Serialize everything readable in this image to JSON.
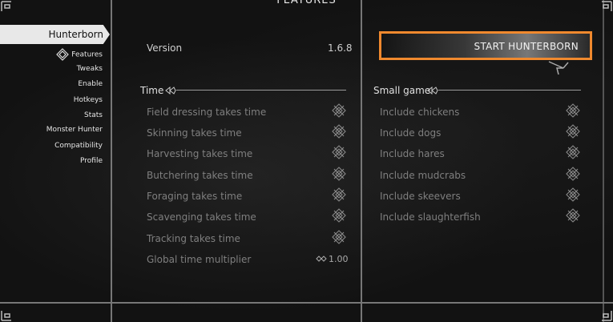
{
  "page_title": "FEATURES",
  "sidebar": {
    "selected": "Hunterborn",
    "items": [
      {
        "label": "Features",
        "icon": "knot-icon"
      },
      {
        "label": "Tweaks"
      },
      {
        "label": "Enable"
      },
      {
        "label": "Hotkeys"
      },
      {
        "label": "Stats"
      },
      {
        "label": "Monster Hunter"
      },
      {
        "label": "Compatibility"
      },
      {
        "label": "Profile"
      }
    ]
  },
  "version": {
    "label": "Version",
    "value": "1.6.8"
  },
  "start_button": {
    "label": "START HUNTERBORN"
  },
  "time_section": {
    "header": "Time",
    "rows": [
      {
        "label": "Field dressing takes time"
      },
      {
        "label": "Skinning takes time"
      },
      {
        "label": "Harvesting takes time"
      },
      {
        "label": "Butchering takes time"
      },
      {
        "label": "Foraging takes time"
      },
      {
        "label": "Scavenging takes time"
      },
      {
        "label": "Tracking takes time"
      },
      {
        "label": "Global time multiplier",
        "value": "1.00"
      }
    ]
  },
  "small_game_section": {
    "header": "Small game",
    "rows": [
      {
        "label": "Include chickens"
      },
      {
        "label": "Include dogs"
      },
      {
        "label": "Include hares"
      },
      {
        "label": "Include mudcrabs"
      },
      {
        "label": "Include skeevers"
      },
      {
        "label": "Include slaughterfish"
      }
    ]
  },
  "colors": {
    "accent": "#f0892e",
    "panel_line": "#777777"
  }
}
